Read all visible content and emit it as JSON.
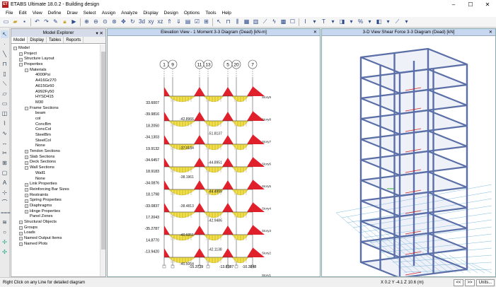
{
  "window": {
    "title": "ETABS Ultimate 18.0.2 - Building design",
    "app_icon_text": "ET",
    "minimize": "–",
    "maximize": "☐",
    "close": "✕"
  },
  "menu": [
    "File",
    "Edit",
    "View",
    "Define",
    "Draw",
    "Select",
    "Assign",
    "Analyze",
    "Display",
    "Design",
    "Options",
    "Tools",
    "Help"
  ],
  "toolbar_icons": [
    "new-file",
    "open-folder",
    "save",
    "undo",
    "redo",
    "pencil",
    "lock",
    "run",
    "zoom-in",
    "zoom-out",
    "zoom-window",
    "zoom-fit",
    "pan",
    "rotate",
    "3d-view",
    "plan-view",
    "elevation-view",
    "up",
    "down",
    "display",
    "check",
    "grid",
    "cursor",
    "frame",
    "column",
    "beam",
    "wall",
    "text-I",
    "text-T",
    "misc"
  ],
  "explorer": {
    "title": "Model Explorer",
    "close": "✕",
    "pin": "▾",
    "tabs": [
      "Model",
      "Display",
      "Tables",
      "Reports"
    ],
    "tree": [
      {
        "label": "Model",
        "depth": 0,
        "exp": "−"
      },
      {
        "label": "Project",
        "depth": 1,
        "exp": "+"
      },
      {
        "label": "Structure Layout",
        "depth": 1,
        "exp": "+"
      },
      {
        "label": "Properties",
        "depth": 1,
        "exp": "−"
      },
      {
        "label": "Materials",
        "depth": 2,
        "exp": "−"
      },
      {
        "label": "4000Psi",
        "depth": 3,
        "exp": ""
      },
      {
        "label": "A416Gr270",
        "depth": 3,
        "exp": ""
      },
      {
        "label": "A615Gr60",
        "depth": 3,
        "exp": ""
      },
      {
        "label": "A992Fy50",
        "depth": 3,
        "exp": ""
      },
      {
        "label": "HYSD415",
        "depth": 3,
        "exp": ""
      },
      {
        "label": "M30",
        "depth": 3,
        "exp": ""
      },
      {
        "label": "Frame Sections",
        "depth": 2,
        "exp": "−"
      },
      {
        "label": "beam",
        "depth": 3,
        "exp": ""
      },
      {
        "label": "col",
        "depth": 3,
        "exp": ""
      },
      {
        "label": "ConcBm",
        "depth": 3,
        "exp": ""
      },
      {
        "label": "ConcCol",
        "depth": 3,
        "exp": ""
      },
      {
        "label": "SteelBm",
        "depth": 3,
        "exp": ""
      },
      {
        "label": "SteelCol",
        "depth": 3,
        "exp": ""
      },
      {
        "label": "None",
        "depth": 3,
        "exp": ""
      },
      {
        "label": "Tendon Sections",
        "depth": 2,
        "exp": "+"
      },
      {
        "label": "Slab Sections",
        "depth": 2,
        "exp": "+"
      },
      {
        "label": "Deck Sections",
        "depth": 2,
        "exp": "+"
      },
      {
        "label": "Wall Sections",
        "depth": 2,
        "exp": "−"
      },
      {
        "label": "Wall1",
        "depth": 3,
        "exp": ""
      },
      {
        "label": "None",
        "depth": 3,
        "exp": ""
      },
      {
        "label": "Link Properties",
        "depth": 2,
        "exp": "+"
      },
      {
        "label": "Reinforcing Bar Sizes",
        "depth": 2,
        "exp": "+"
      },
      {
        "label": "Restraints",
        "depth": 2,
        "exp": "+"
      },
      {
        "label": "Spring Properties",
        "depth": 2,
        "exp": "+"
      },
      {
        "label": "Diaphragms",
        "depth": 2,
        "exp": "+"
      },
      {
        "label": "Hinge Properties",
        "depth": 2,
        "exp": "+"
      },
      {
        "label": "Panel Zones",
        "depth": 2,
        "exp": ""
      },
      {
        "label": "Structural Objects",
        "depth": 1,
        "exp": "+"
      },
      {
        "label": "Groups",
        "depth": 1,
        "exp": "+"
      },
      {
        "label": "Loads",
        "depth": 1,
        "exp": "+"
      },
      {
        "label": "Named Output Items",
        "depth": 1,
        "exp": "+"
      },
      {
        "label": "Named Plots",
        "depth": 1,
        "exp": "+"
      }
    ]
  },
  "elevation_view": {
    "title": "Elevation View - 1   Moment 3-3 Diagram   (Dead)  [kN-m]",
    "close": "✕",
    "grid_bubbles": [
      "1",
      "9",
      "11",
      "13",
      "5",
      "20",
      "7"
    ],
    "left_values": [
      "33.6007",
      "-39.9816",
      "18.2050",
      "-34.1303",
      "19.9132",
      "-34.6457",
      "18.9183",
      "-34.0876",
      "18.1798",
      "-33.0837",
      "17.2043",
      "-35.2787",
      "14.8770",
      "-13.9420"
    ],
    "bottom_values": [
      "-15.3729",
      "-13.8987",
      "-10.3848"
    ],
    "story_labels": [
      "Story9",
      "Story8",
      "Story7",
      "Story6",
      "Story5",
      "Story4",
      "Story3",
      "Story2",
      "Story1",
      "Base"
    ],
    "inner_values": [
      "-42.8966",
      "-51.8137",
      "-37.0134",
      "-44.8951",
      "-38.1961",
      "-44.4999",
      "-38.4813",
      "-42.9486",
      "-40.6051",
      "-42.1138",
      "-40.5054"
    ]
  },
  "view3d": {
    "title": "3-D View   Shear Force 3-3 Diagram   (Dead)  [kN]",
    "close": "✕"
  },
  "status": {
    "message": "Right Click on any Line for detailed diagram",
    "coords": "X 0.2  Y -4.1  Z 10.6 (m)",
    "prev": "<<",
    "next": ">>",
    "units": "Units..."
  },
  "colors": {
    "positive": "#f2e04a",
    "negative": "#e0202a",
    "frame": "#5a6fa8",
    "grid": "#5aa9d8",
    "title_bar_bg": "#c8d7f0"
  }
}
